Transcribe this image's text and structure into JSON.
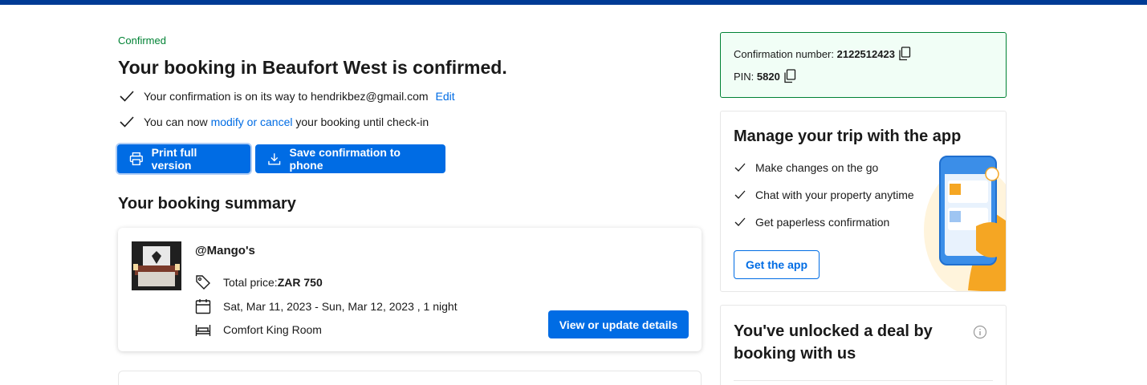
{
  "status": "Confirmed",
  "title": "Your booking in Beaufort West is confirmed.",
  "confirmation_row": {
    "text": "Your confirmation is on its way to hendrikbez@gmail.com",
    "edit_link": "Edit",
    "icon": "check-icon"
  },
  "modify_row": {
    "prefix": "You can now",
    "link": "modify or cancel",
    "suffix": "your booking until check-in",
    "icon": "check-icon"
  },
  "actions": {
    "print_label": "Print full version",
    "print_icon": "printer-icon",
    "save_label": "Save confirmation to phone",
    "save_icon": "download-icon"
  },
  "summary": {
    "heading": "Your booking summary",
    "property_name": "@Mango's",
    "price_label": "Total price:",
    "price_value": "ZAR 750",
    "dates": "Sat, Mar 11, 2023 - Sun, Mar 12, 2023 , 1 night",
    "room": "Comfort King Room",
    "view_button": "View or update details"
  },
  "confirmation_box": {
    "number_label": "Confirmation number:",
    "number_value": "2122512423",
    "pin_label": "PIN:",
    "pin_value": "5820",
    "copy_icon": "copy-icon"
  },
  "app_promo": {
    "heading": "Manage your trip with the app",
    "items": [
      "Make changes on the go",
      "Chat with your property anytime",
      "Get paperless confirmation"
    ],
    "button": "Get the app"
  },
  "deal": {
    "heading": "You've unlocked a deal by booking with us",
    "icon": "info-icon"
  },
  "colors": {
    "brand_blue": "#006ce4",
    "header_blue": "#003b95",
    "success_green": "#008234",
    "success_bg": "#f1fef6"
  }
}
